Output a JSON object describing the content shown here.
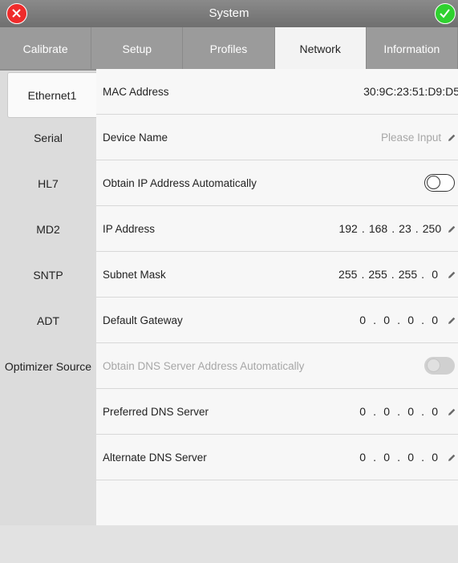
{
  "window": {
    "title": "System"
  },
  "tabs": [
    {
      "label": "Calibrate",
      "active": false
    },
    {
      "label": "Setup",
      "active": false
    },
    {
      "label": "Profiles",
      "active": false
    },
    {
      "label": "Network",
      "active": true
    },
    {
      "label": "Information",
      "active": false
    }
  ],
  "sidebar": {
    "items": [
      {
        "label": "Ethernet1",
        "active": true
      },
      {
        "label": "Serial",
        "active": false
      },
      {
        "label": "HL7",
        "active": false
      },
      {
        "label": "MD2",
        "active": false
      },
      {
        "label": "SNTP",
        "active": false
      },
      {
        "label": "ADT",
        "active": false
      },
      {
        "label": "Optimizer Source",
        "active": false
      }
    ]
  },
  "network": {
    "mac": {
      "label": "MAC Address",
      "value": "30:9C:23:51:D9:D5"
    },
    "device_name": {
      "label": "Device Name",
      "placeholder": "Please Input"
    },
    "obtain_ip": {
      "label": "Obtain IP Address Automatically",
      "on": false
    },
    "ip": {
      "label": "IP Address",
      "octets": [
        "192",
        "168",
        "23",
        "250"
      ]
    },
    "subnet": {
      "label": "Subnet Mask",
      "octets": [
        "255",
        "255",
        "255",
        "0"
      ]
    },
    "gateway": {
      "label": "Default Gateway",
      "octets": [
        "0",
        "0",
        "0",
        "0"
      ]
    },
    "obtain_dns": {
      "label": "Obtain DNS Server Address Automatically",
      "on": false,
      "enabled": false
    },
    "preferred_dns": {
      "label": "Preferred DNS Server",
      "octets": [
        "0",
        "0",
        "0",
        "0"
      ]
    },
    "alternate_dns": {
      "label": "Alternate DNS Server",
      "octets": [
        "0",
        "0",
        "0",
        "0"
      ]
    }
  },
  "ip_separator": ".",
  "icons": {
    "close": "close-icon",
    "confirm": "check-icon",
    "edit": "pencil-icon"
  },
  "colors": {
    "close": "#ef2b2b",
    "confirm": "#2fd12f",
    "titlebar": "#7d7d7d",
    "tabbar": "#9b9b9b"
  }
}
